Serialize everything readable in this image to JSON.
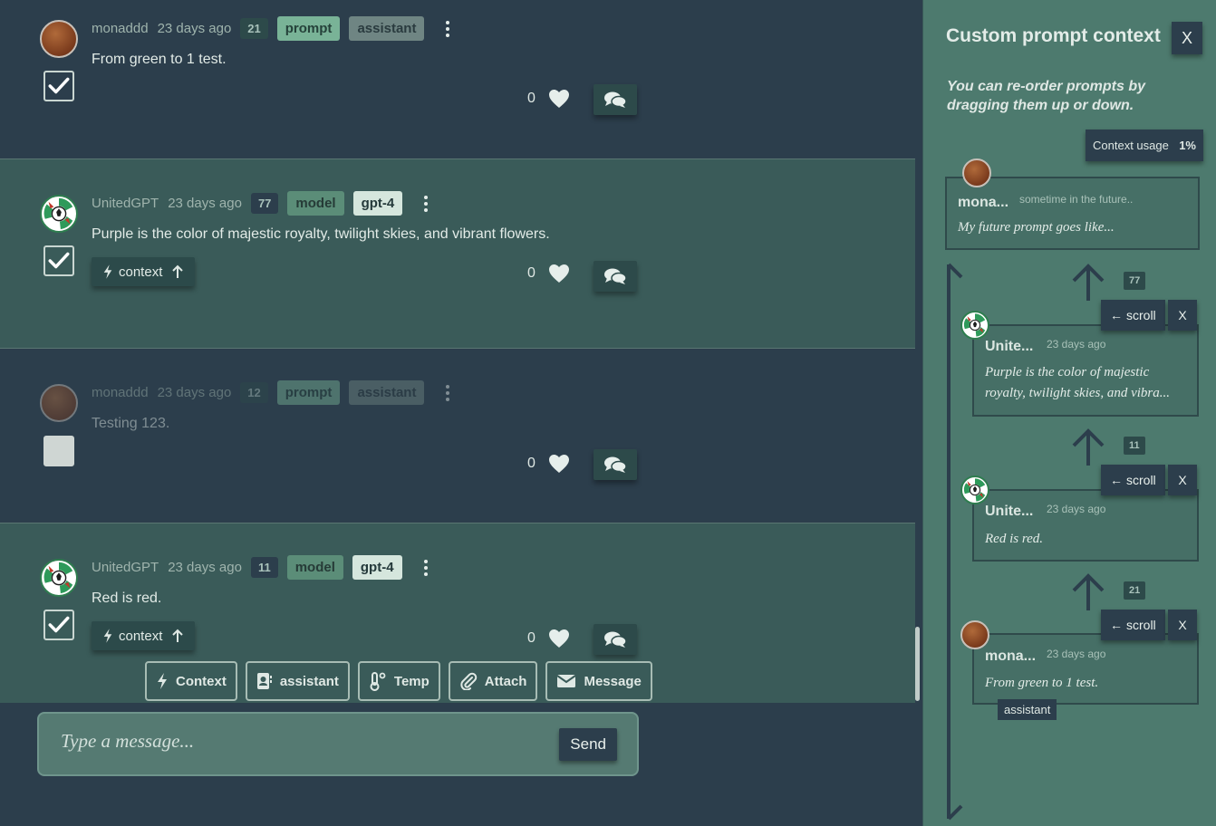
{
  "messages": [
    {
      "user": "monaddd",
      "time": "23 days ago",
      "count": "21",
      "tag1": "prompt",
      "tag2": "assistant",
      "text": "From green to 1 test.",
      "likes": "0"
    },
    {
      "user": "UnitedGPT",
      "time": "23 days ago",
      "count": "77",
      "tag1": "model",
      "tag2": "gpt-4",
      "text": "Purple is the color of majestic royalty, twilight skies, and vibrant flowers.",
      "likes": "0",
      "context_label": "context"
    },
    {
      "user": "monaddd",
      "time": "23 days ago",
      "count": "12",
      "tag1": "prompt",
      "tag2": "assistant",
      "text": "Testing 123.",
      "likes": "0"
    },
    {
      "user": "UnitedGPT",
      "time": "23 days ago",
      "count": "11",
      "tag1": "model",
      "tag2": "gpt-4",
      "text": "Red is red.",
      "likes": "0",
      "context_label": "context"
    }
  ],
  "toolbar": {
    "context": "Context",
    "assistant": "assistant",
    "temp": "Temp",
    "attach": "Attach",
    "message": "Message"
  },
  "composer": {
    "placeholder": "Type a message...",
    "send": "Send"
  },
  "panel": {
    "title": "Custom prompt context",
    "close": "X",
    "hint": "You can re-order prompts by dragging them up or down.",
    "usage_label": "Context usage",
    "usage_value": "1%",
    "future": {
      "name": "mona...",
      "time": "sometime in the future..",
      "text": "My future prompt goes like..."
    },
    "items": [
      {
        "count": "77",
        "scroll": "scroll",
        "close": "X",
        "name": "Unite...",
        "time": "23 days ago",
        "text": "Purple is the color of majestic royalty, twilight skies, and vibra..."
      },
      {
        "count": "11",
        "scroll": "scroll",
        "close": "X",
        "name": "Unite...",
        "time": "23 days ago",
        "text": "Red is red."
      },
      {
        "count": "21",
        "scroll": "scroll",
        "close": "X",
        "name": "mona...",
        "time": "23 days ago",
        "text": "From green to 1 test.",
        "role": "assistant"
      }
    ]
  },
  "icons": [
    "check-icon",
    "heart-icon",
    "comment-icon",
    "kebab-icon",
    "bolt-icon",
    "arrow-up-icon",
    "contact-icon",
    "thermometer-icon",
    "paperclip-icon",
    "envelope-icon"
  ]
}
